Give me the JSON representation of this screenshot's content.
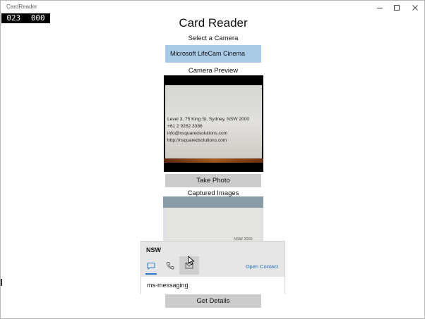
{
  "window": {
    "title": "CardReader"
  },
  "counter": {
    "left": "023",
    "right": "000"
  },
  "app": {
    "title": "Card Reader"
  },
  "camera": {
    "select_label": "Select a Camera",
    "selected": "Microsoft LifeCam Cinema"
  },
  "preview": {
    "label": "Camera Preview",
    "card_lines": [
      "Level 3, 75 King St, Sydney, NSW 2000",
      "+61 2 9262 3386",
      "info@nsquaredsolutions.com",
      "http://nsquaredsolutions.com"
    ]
  },
  "take_photo": {
    "label": "Take Photo"
  },
  "captured": {
    "label": "Captured Images",
    "fragment": "NSW 2000"
  },
  "contact_popup": {
    "name": "NSW",
    "open_contact": "Open Contact",
    "method": "ms-messaging"
  },
  "get_details": {
    "label": "Get Details"
  },
  "colors": {
    "select_bg": "#a9cbe8",
    "button_bg": "#cccccc",
    "accent": "#2c78c8",
    "link": "#1f6ab5"
  },
  "icons": [
    "minimize-icon",
    "maximize-icon",
    "close-icon",
    "message-icon",
    "phone-icon",
    "mail-icon",
    "cursor-icon"
  ]
}
